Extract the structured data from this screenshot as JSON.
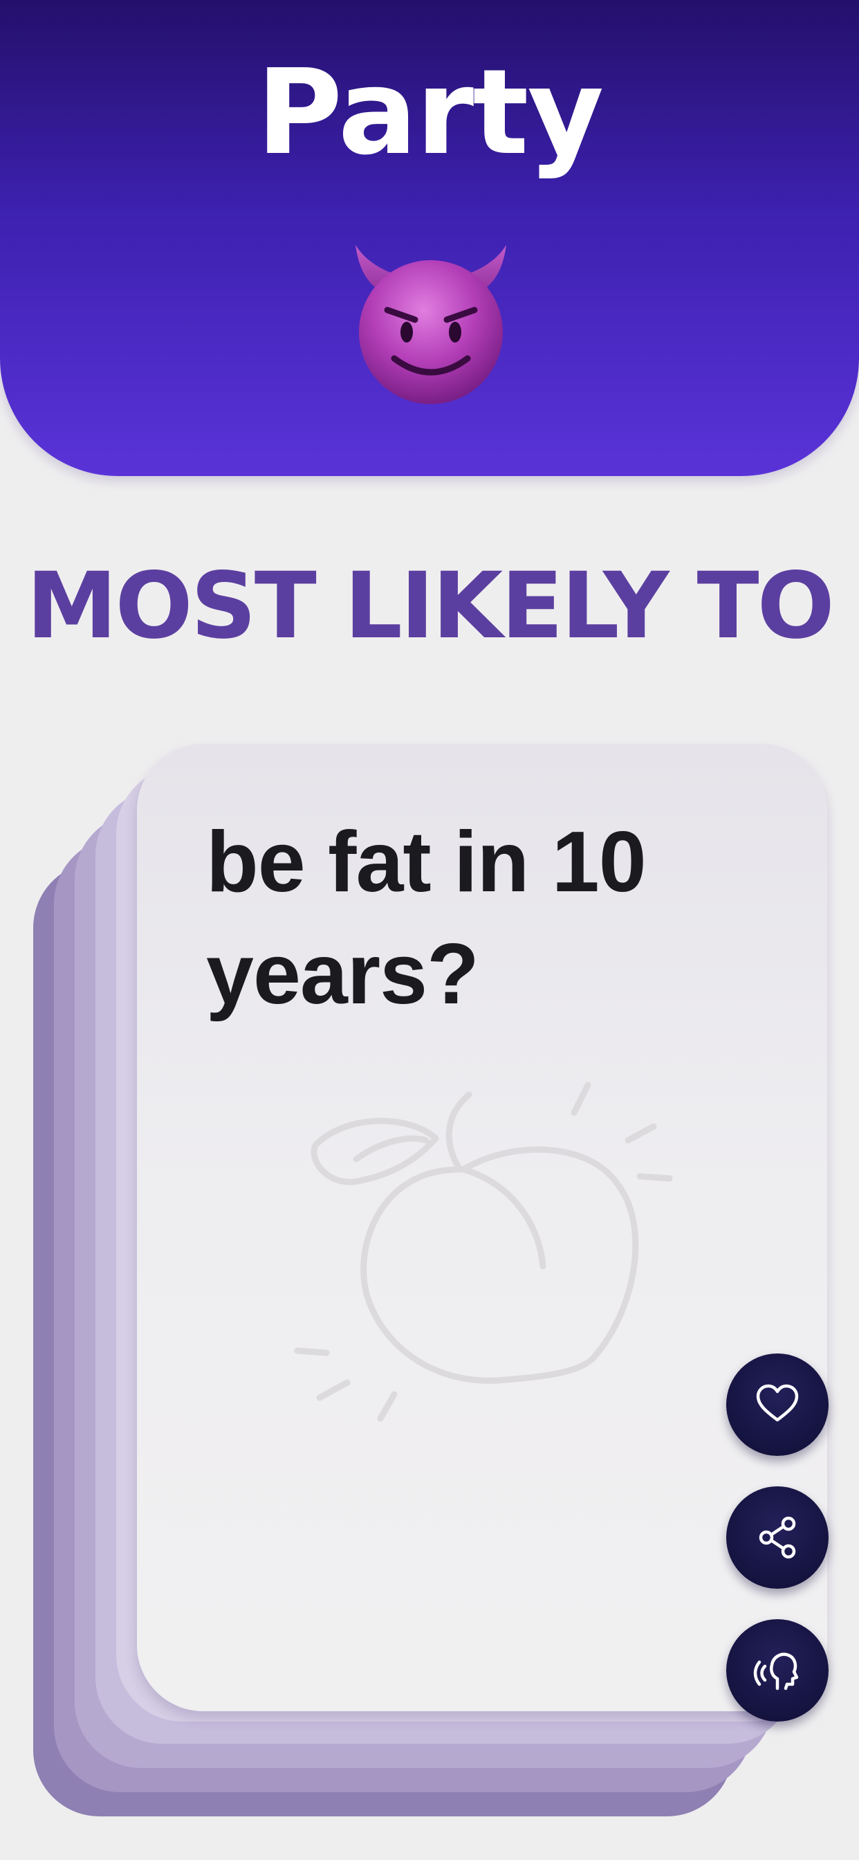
{
  "header": {
    "title": "Party",
    "icon": "smiling-devil-emoji-icon"
  },
  "category_title": "MOST LIKELY TO",
  "card": {
    "question": "be fat in 10 years?",
    "illustration": "peach-icon"
  },
  "actions": [
    {
      "name": "favorite",
      "icon": "heart-icon"
    },
    {
      "name": "share",
      "icon": "share-icon"
    },
    {
      "name": "read-aloud",
      "icon": "speak-head-icon"
    }
  ],
  "colors": {
    "header_top": "#24106b",
    "header_bottom": "#5a33d8",
    "category_text": "#5b3fa0",
    "button_bg": "#15133f",
    "background": "#efeeef"
  }
}
